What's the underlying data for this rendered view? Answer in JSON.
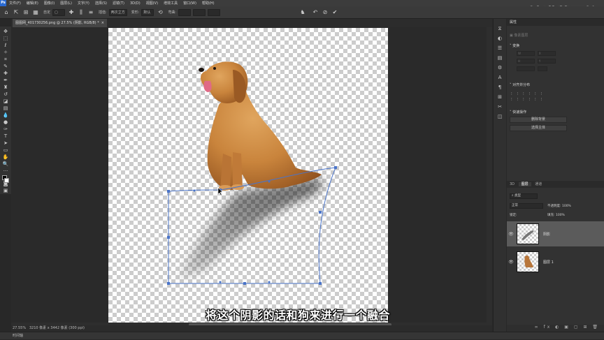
{
  "app": {
    "logo": "Ps"
  },
  "menu": [
    "文件(F)",
    "编辑(E)",
    "图像(I)",
    "图层(L)",
    "文字(Y)",
    "选择(S)",
    "滤镜(T)",
    "3D(D)",
    "视图(V)",
    "增效工具",
    "窗口(W)",
    "帮助(H)"
  ],
  "watermark": "妙诺葛网校",
  "options": {
    "interp_label": "插值:",
    "interp_value": "两次立方",
    "warp_label": "变形:",
    "warp_value": "默认",
    "size_label": "自定",
    "curve_label": "弯曲:"
  },
  "document": {
    "tab_title": "图图网_401730256.png @ 27.5% (阴影, RGB/8) *",
    "close": "×"
  },
  "status": {
    "zoom": "27.55%",
    "size": "3210 像素 x 3442 像素 (300 ppi)"
  },
  "bottom_tab": "时间轴",
  "subtitle": "将这个阴影的话和狗来进行一个融合",
  "panels": {
    "properties_tab": "属性",
    "layer_props": "像素图层",
    "transform": "变换",
    "w_field": "W",
    "h_field": "H",
    "x_field": "X",
    "y_field": "Y",
    "align": "对齐并分布",
    "quick_actions": "快速操作",
    "remove_bg": "删除背景",
    "select_subject": "选择主体",
    "layers_tabs": [
      "3D",
      "图层",
      "通道"
    ],
    "kind_filter": "类型",
    "blend_mode": "正常",
    "opacity_label": "不透明度:",
    "opacity_value": "100%",
    "lock_label": "锁定:",
    "fill_label": "填充:",
    "fill_value": "100%",
    "layers": [
      {
        "name": "阴影",
        "eye": "👁",
        "selected": true
      },
      {
        "name": "图层 1",
        "eye": "👁",
        "selected": false
      }
    ]
  },
  "colors": {
    "accent": "#2a6ad1",
    "selection": "#4a74c9",
    "panel_bg": "#323232"
  }
}
